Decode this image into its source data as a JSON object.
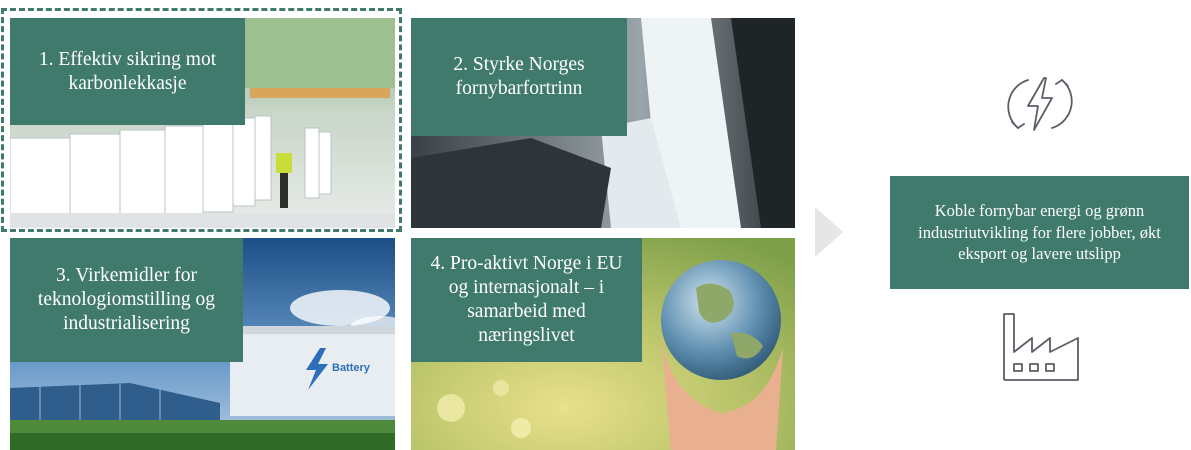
{
  "tiles": [
    {
      "number": "1.",
      "label": "1. Effektiv sikring mot karbonlekkasje"
    },
    {
      "number": "2.",
      "label": "2. Styrke Norges fornybarfortrinn"
    },
    {
      "number": "3.",
      "label": "3. Virkemidler for teknologiomstilling og industrialisering"
    },
    {
      "number": "4.",
      "label": "4. Pro-aktivt Norge i EU og internasjonalt – i samarbeid med næringslivet"
    }
  ],
  "battery_text": "Battery",
  "summary": "Koble fornybar energi og grønn industriutvikling for flere jobber, økt eksport og lavere utslipp",
  "icons": {
    "top": "renewable-energy-icon",
    "bottom": "factory-icon",
    "arrow": "chevron-right-icon"
  },
  "colors": {
    "accent": "#3f7a6d",
    "arrow": "#e6e6e6",
    "icon_stroke": "#5a5f66"
  }
}
